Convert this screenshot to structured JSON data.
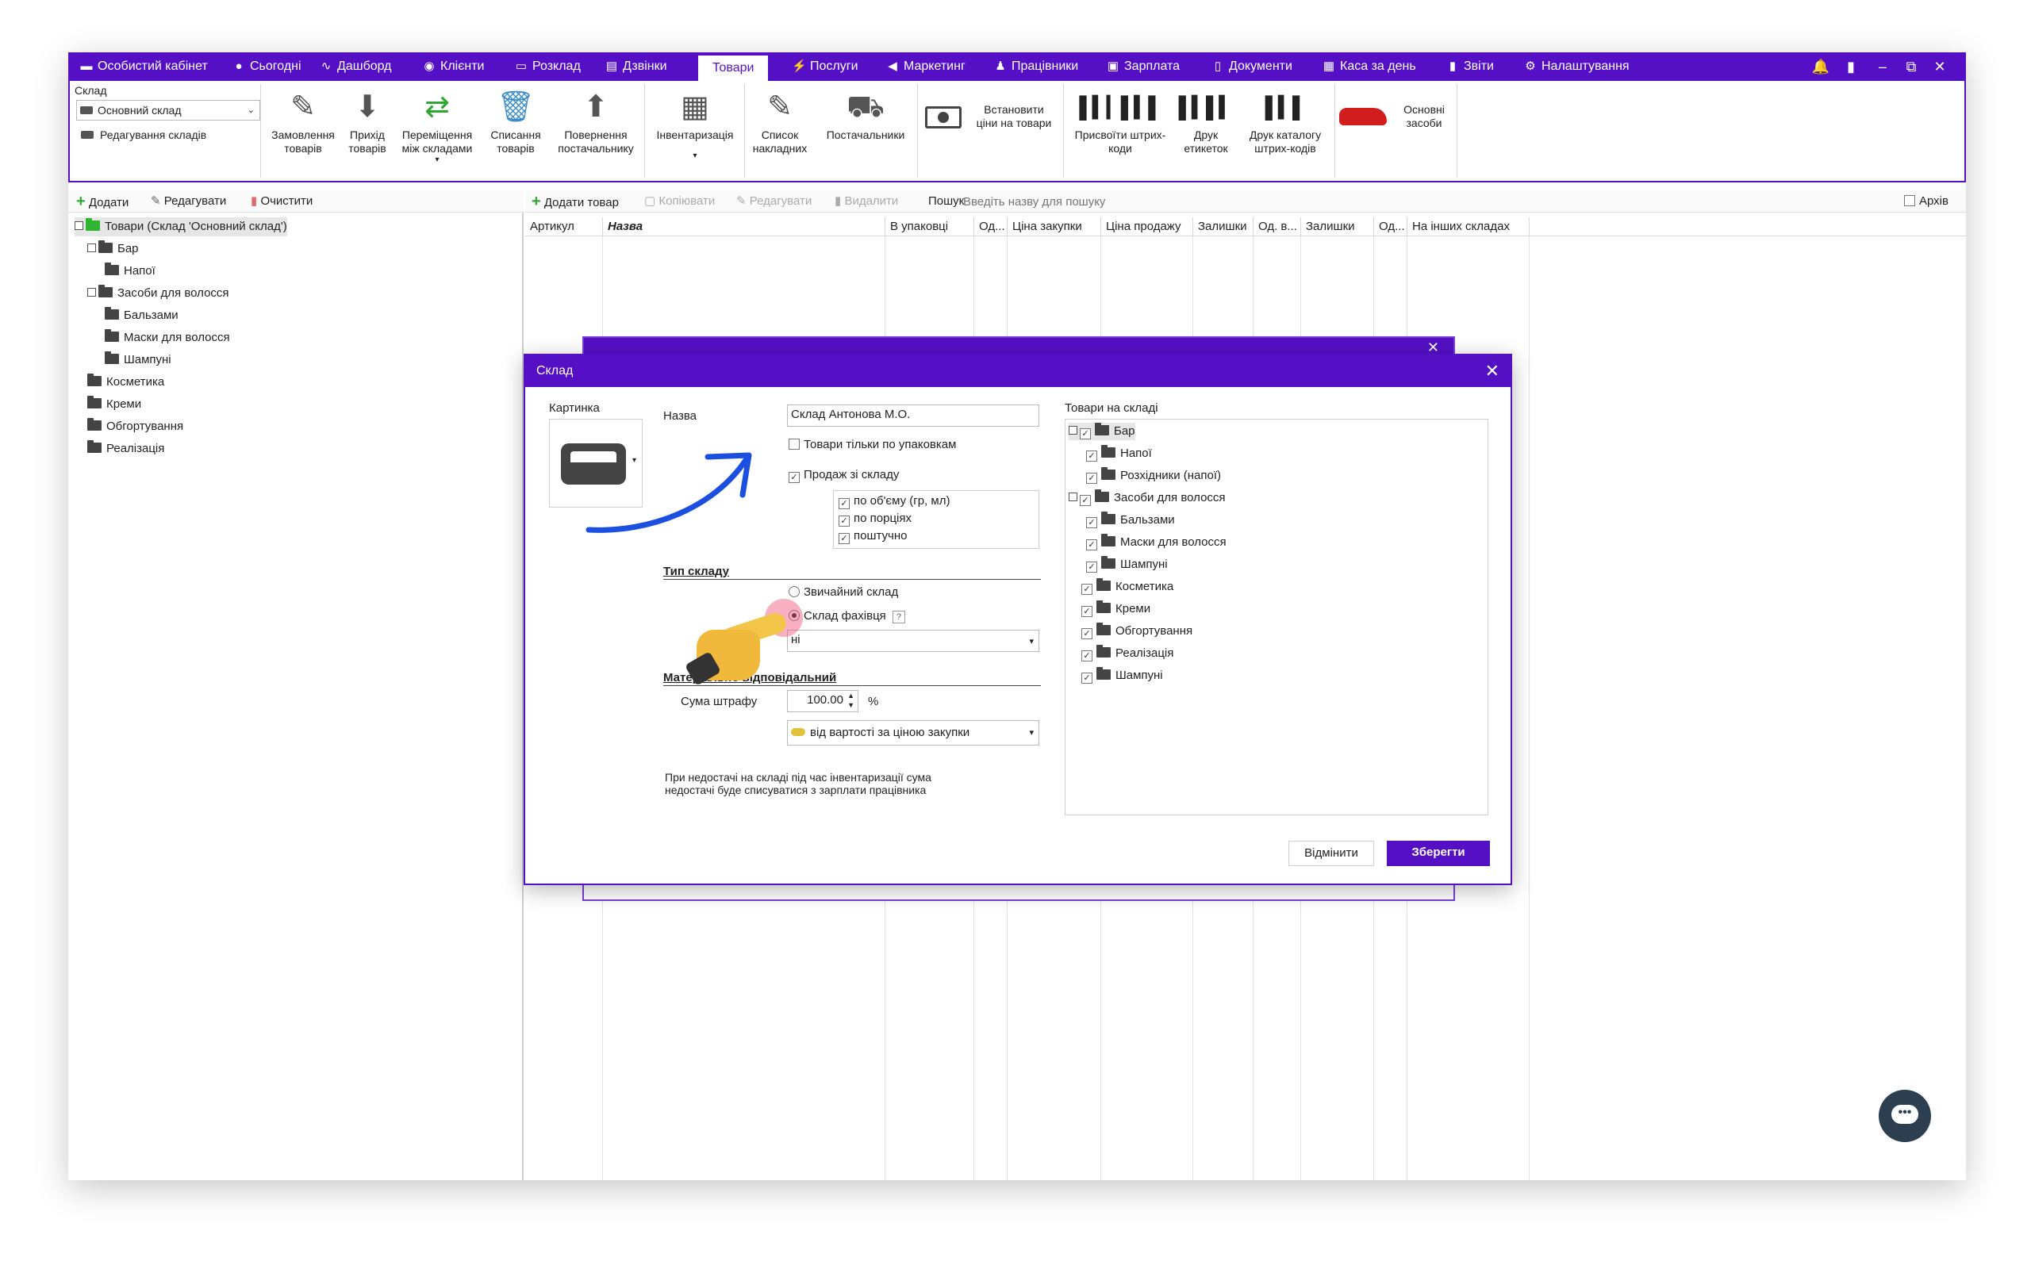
{
  "menubar": {
    "items": [
      {
        "label": "Особистий кабінет",
        "icon": "cabinet-icon"
      },
      {
        "label": "Сьогодні",
        "icon": "clock-icon"
      },
      {
        "label": "Дашборд",
        "icon": "pulse-icon"
      },
      {
        "label": "Клієнти",
        "icon": "user-circle-icon"
      },
      {
        "label": "Розклад",
        "icon": "calendar-icon"
      },
      {
        "label": "Дзвінки",
        "icon": "phone-icon"
      },
      {
        "label": "Товари",
        "icon": ""
      },
      {
        "label": "Послуги",
        "icon": "lightning-icon"
      },
      {
        "label": "Маркетинг",
        "icon": "megaphone-icon"
      },
      {
        "label": "Працівники",
        "icon": "person-icon"
      },
      {
        "label": "Зарплата",
        "icon": "money-icon"
      },
      {
        "label": "Документи",
        "icon": "document-icon"
      },
      {
        "label": "Каса за день",
        "icon": "calculator-icon"
      },
      {
        "label": "Звіти",
        "icon": "bar-chart-icon"
      },
      {
        "label": "Налаштування",
        "icon": "gear-icon"
      }
    ]
  },
  "ribbon": {
    "warehouse_label": "Склад",
    "warehouse_select": "Основний склад",
    "edit_warehouses": "Редагування складів",
    "buttons": [
      {
        "line1": "Замовлення",
        "line2": "товарів",
        "icon": "pencil-icon"
      },
      {
        "line1": "Прихід",
        "line2": "товарів",
        "icon": "inbox-download-icon"
      },
      {
        "line1": "Переміщення",
        "line2": "між складами",
        "icon": "transfer-icon"
      },
      {
        "line1": "Списання",
        "line2": "товарів",
        "icon": "trash-bin-icon"
      },
      {
        "line1": "Повернення",
        "line2": "постачальнику",
        "icon": "inbox-upload-icon"
      },
      {
        "line1": "Інвентаризація",
        "line2": "",
        "icon": "calculator-icon"
      },
      {
        "line1": "Список",
        "line2": "накладних",
        "icon": "pencil-icon"
      },
      {
        "line1": "Постачальники",
        "line2": "",
        "icon": "truck-icon"
      },
      {
        "line1": "Встановити",
        "line2": "ціни на товари",
        "icon": "banknote-icon"
      },
      {
        "line1": "Присвоїти штрих-",
        "line2": "коди",
        "icon": "barcode-icon"
      },
      {
        "line1": "Друк",
        "line2": "етикеток",
        "icon": "barcode-icon"
      },
      {
        "line1": "Друк каталогу",
        "line2": "штрих-кодів",
        "icon": "barcode-catalog-icon"
      },
      {
        "line1": "Основні",
        "line2": "засоби",
        "icon": "car-icon"
      }
    ]
  },
  "left_toolbar": {
    "add": "Додати",
    "edit": "Редагувати",
    "clear": "Очистити"
  },
  "left_tree": [
    {
      "label": "Товари (Склад 'Основний склад')",
      "level": 0,
      "root": true
    },
    {
      "label": "Бар",
      "level": 1
    },
    {
      "label": "Напої",
      "level": 2
    },
    {
      "label": "Засоби для волосся",
      "level": 1
    },
    {
      "label": "Бальзами",
      "level": 2
    },
    {
      "label": "Маски для волосся",
      "level": 2
    },
    {
      "label": "Шампуні",
      "level": 2
    },
    {
      "label": "Косметика",
      "level": 1
    },
    {
      "label": "Креми",
      "level": 1
    },
    {
      "label": "Обгортування",
      "level": 1
    },
    {
      "label": "Реалізація",
      "level": 1
    }
  ],
  "right_toolbar": {
    "add": "Додати товар",
    "copy": "Копіювати",
    "edit": "Редагувати",
    "delete": "Видалити",
    "search_label": "Пошук",
    "search_placeholder": "Введіть назву для пошуку",
    "archive": "Архів"
  },
  "table_columns": [
    "Артикул",
    "Назва",
    "В упаковці",
    "Од...",
    "Ціна закупки",
    "Ціна продажу",
    "Залишки",
    "Од. в...",
    "Залишки",
    "Од...",
    "На інших складах"
  ],
  "dialog": {
    "title": "Склад",
    "picture_label": "Картинка",
    "name_label": "Назва",
    "name_value": "Склад Антонова М.О.",
    "only_packages": "Товари тільки по упаковкам",
    "sale_from_warehouse": "Продаж зі складу",
    "sale_options": [
      "по об'єму (гр, мл)",
      "по порціях",
      "поштучно"
    ],
    "type_header": "Тип складу",
    "type_regular": "Звичайний склад",
    "type_specialist": "Склад фахівця",
    "help_mark": "?",
    "specialist_select": "ні",
    "responsible_header": "Матеріально відповідальний",
    "fine_label": "Сума штрафу",
    "fine_value": "100.00",
    "fine_unit": "%",
    "fine_basis": "від вартості за ціною закупки",
    "note_line1": "При недостачі на складі під час інвентаризації сума",
    "note_line2": "недостачі буде списуватися з зарплати працівника",
    "goods_label": "Товари на складі",
    "goods_tree": [
      {
        "label": "Бар",
        "level": 0
      },
      {
        "label": "Напої",
        "level": 1
      },
      {
        "label": "Розхідники (напої)",
        "level": 1
      },
      {
        "label": "Засоби для волосся",
        "level": 0
      },
      {
        "label": "Бальзами",
        "level": 1
      },
      {
        "label": "Маски для волосся",
        "level": 1
      },
      {
        "label": "Шампуні",
        "level": 1
      },
      {
        "label": "Косметика",
        "level": 0
      },
      {
        "label": "Креми",
        "level": 0
      },
      {
        "label": "Обгортування",
        "level": 0
      },
      {
        "label": "Реалізація",
        "level": 0
      },
      {
        "label": "Шампуні",
        "level": 0
      }
    ],
    "cancel": "Відмінити",
    "save": "Зберегти"
  },
  "colors": {
    "brand": "#5510c6",
    "annotation_arrow": "#1a4fe0"
  }
}
